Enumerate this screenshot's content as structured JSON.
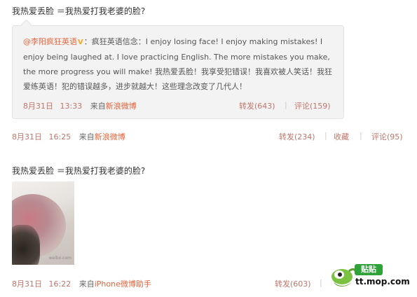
{
  "post1": {
    "text": "我热爱丢脸 ＝我热爱打我老婆的脸?",
    "retweet": {
      "author": "@李阳疯狂英语",
      "verified_mark": "V",
      "body": "：疯狂英语信念：I enjoy losing face! I enjoy making mistakes! I enjoy being laughed at. I love practicing English. The more mistakes you make, the more progress you will make! 我热爱丢脸！我享受犯错误！我喜欢被人笑话！我狂爱练英语！犯的错误越多，进步就越大！这些理念改变了几代人！",
      "date": "8月31日",
      "time": "13:33",
      "source_prefix": "来自",
      "source": "新浪微博",
      "repost": "转发(643)",
      "sep": "|",
      "comment": "评论(159)"
    },
    "meta": {
      "date": "8月31日",
      "time": "16:25",
      "source_prefix": "来自",
      "source": "新浪微博",
      "repost": "转发(234)",
      "sep": "|",
      "favorite": "收藏",
      "comment": "评论(95)"
    }
  },
  "post2": {
    "text": "我热爱丢脸 ＝我热爱打我老婆的脸?",
    "image_watermark": "weibo.com",
    "meta": {
      "date": "8月31日",
      "time": "16:22",
      "source_prefix": "来自",
      "source": "iPhone微博助手",
      "repost": "转发(603)",
      "sep": "|"
    }
  },
  "watermark": {
    "tag": "贴贴",
    "url": "tt.mop.com"
  },
  "colors": {
    "link": "#e5643b",
    "meta_time": "#c0756a",
    "card_bg": "#f3f3f3",
    "logo_green": "#2fa33a"
  }
}
